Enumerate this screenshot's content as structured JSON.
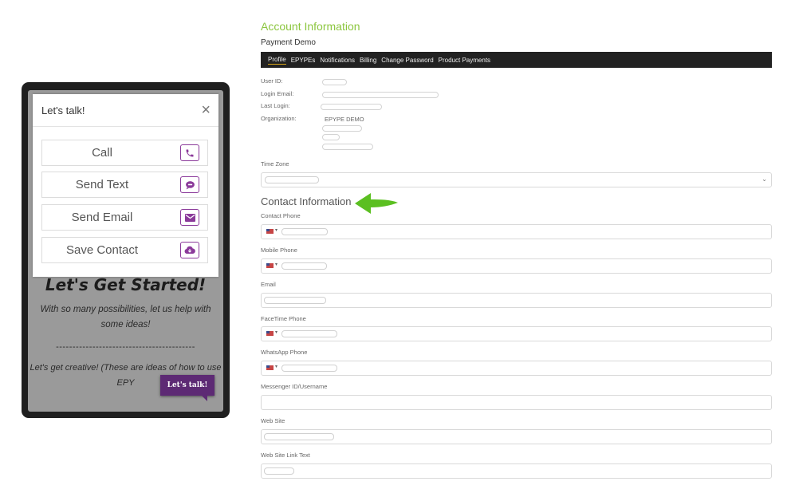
{
  "phone": {
    "modal": {
      "title": "Let's talk!",
      "close_glyph": "×",
      "buttons": [
        {
          "label": "Call",
          "icon": "phone-icon"
        },
        {
          "label": "Send Text",
          "icon": "chat-bubble-icon"
        },
        {
          "label": "Send Email",
          "icon": "envelope-icon"
        },
        {
          "label": "Save Contact",
          "icon": "cloud-download-icon"
        }
      ]
    },
    "heading": "Let's Get Started!",
    "paragraph": "With so many possibilities, let us help with some ideas!",
    "divider": "------------------------------------------",
    "creative": "Let's get creative! (These are ideas of how to use EPY",
    "talk_tab": "Let's talk!",
    "accent_color": "#5d2a74"
  },
  "account": {
    "title": "Account Information",
    "subtitle": "Payment Demo",
    "title_color": "#8cc63f",
    "tabs": [
      {
        "label": "Profile",
        "active": true
      },
      {
        "label": "EPYPEs",
        "active": false
      },
      {
        "label": "Notifications",
        "active": false
      },
      {
        "label": "Billing",
        "active": false
      },
      {
        "label": "Change Password",
        "active": false
      },
      {
        "label": "Product Payments",
        "active": false
      }
    ],
    "info": {
      "user_id_label": "User ID:",
      "login_email_label": "Login Email:",
      "last_login_label": "Last Login:",
      "organization_label": "Organization:",
      "organization_value": "EPYPE DEMO"
    },
    "timezone_label": "Time Zone",
    "contact_title": "Contact Information",
    "arrow_color": "#5bbf21",
    "contact_fields": {
      "contact_phone": "Contact Phone",
      "mobile_phone": "Mobile Phone",
      "email": "Email",
      "facetime_phone": "FaceTime Phone",
      "whatsapp_phone": "WhatsApp Phone",
      "messenger_id": "Messenger ID/Username",
      "web_site": "Web Site",
      "web_site_link_text": "Web Site Link Text"
    }
  }
}
